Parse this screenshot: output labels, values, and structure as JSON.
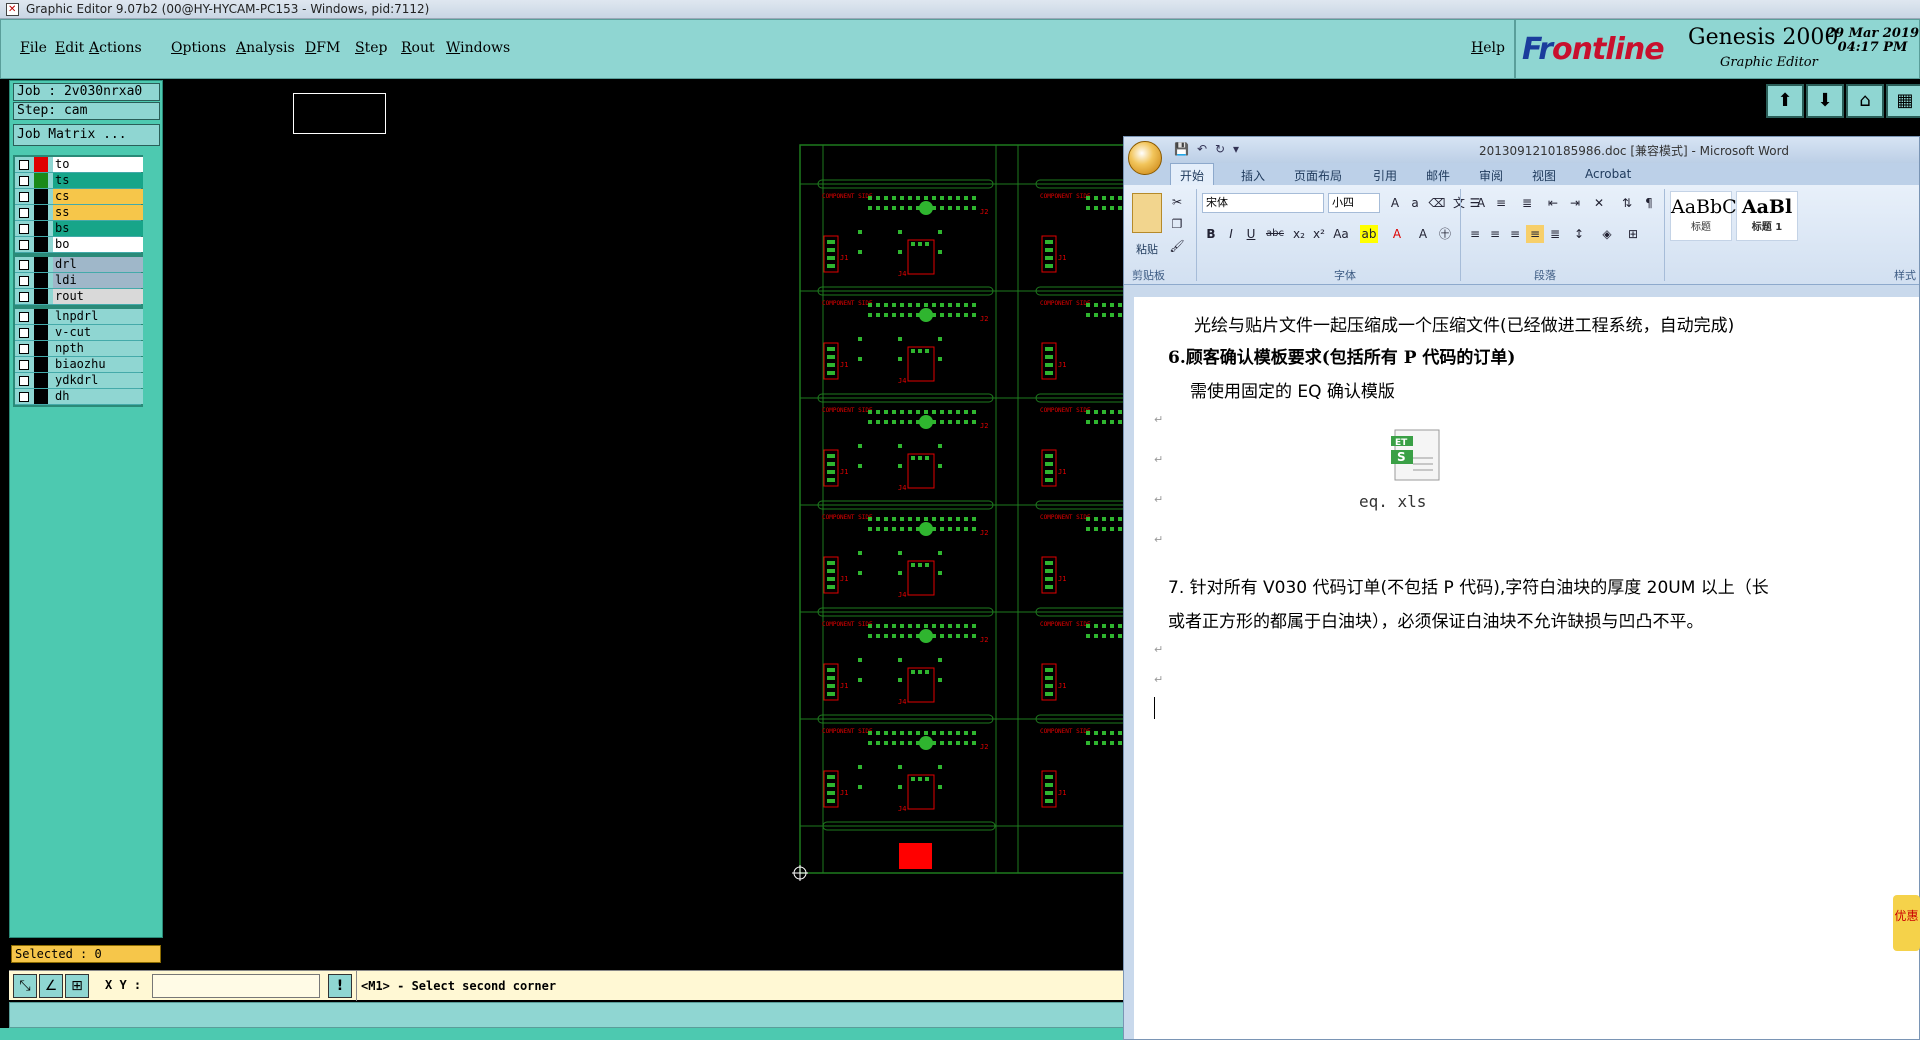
{
  "window": {
    "title": "Graphic Editor 9.07b2 (00@HY-HYCAM-PC153 - Windows, pid:7112)"
  },
  "menu": [
    "File",
    "Edit",
    "Actions",
    "Options",
    "Analysis",
    "DFM",
    "Step",
    "Rout",
    "Windows"
  ],
  "help": "Help",
  "brand": {
    "logo_a": "Fr",
    "logo_b": "ontline",
    "product": "Genesis 2000",
    "subtitle": "Graphic Editor",
    "date": "29 Mar 2019",
    "time": "04:17 PM"
  },
  "job": {
    "job_line": "Job : 2v030nrxa0",
    "step_line": "Step: cam",
    "matrix_button": "Job Matrix ..."
  },
  "layers": {
    "group1": [
      {
        "name": "to",
        "swatch": "#e00000",
        "color": "#ffffff"
      },
      {
        "name": "ts",
        "swatch": "#1a8a1a",
        "color": "#17a589"
      },
      {
        "name": "cs",
        "swatch": "#000000",
        "color": "#f6c64a"
      },
      {
        "name": "ss",
        "swatch": "#000000",
        "color": "#f6c64a"
      },
      {
        "name": "bs",
        "swatch": "#000000",
        "color": "#17a589"
      },
      {
        "name": "bo",
        "swatch": "#000000",
        "color": "#ffffff"
      }
    ],
    "group2": [
      {
        "name": "drl",
        "swatch": "#000000",
        "color": "#9fb7c9"
      },
      {
        "name": "ldi",
        "swatch": "#000000",
        "color": "#9fb7c9"
      },
      {
        "name": "rout",
        "swatch": "#000000",
        "color": "#d9d9d9"
      }
    ],
    "group3": [
      {
        "name": "lnpdrl",
        "swatch": "#000000",
        "color": "#8fd6d2"
      },
      {
        "name": "v-cut",
        "swatch": "#000000",
        "color": "#8fd6d2"
      },
      {
        "name": "npth",
        "swatch": "#000000",
        "color": "#8fd6d2"
      },
      {
        "name": "biaozhu",
        "swatch": "#000000",
        "color": "#8fd6d2"
      },
      {
        "name": "ydkdrl",
        "swatch": "#000000",
        "color": "#8fd6d2"
      },
      {
        "name": "dh",
        "swatch": "#000000",
        "color": "#8fd6d2"
      }
    ]
  },
  "selected": "Selected : 0",
  "status": {
    "xy_label": "X Y :",
    "xy_value": "",
    "message": "<M1> - Select second corner"
  },
  "pcb": {
    "silk_title": "COMPONENT SIDE",
    "label_j1": "J1",
    "label_j4": "J4",
    "label_j2": "J2"
  },
  "word": {
    "doc_title": "2013091210185986.doc [兼容模式] - Microsoft Word",
    "tabs": [
      "开始",
      "插入",
      "页面布局",
      "引用",
      "邮件",
      "审阅",
      "视图",
      "Acrobat"
    ],
    "font_name": "宋体",
    "font_size": "小四",
    "paste": "粘贴",
    "groups": [
      "剪贴板",
      "字体",
      "段落",
      "样式"
    ],
    "styles": [
      {
        "sample": "AaBbC",
        "name": "标题"
      },
      {
        "sample": "AaBl",
        "name": "标题 1"
      }
    ],
    "lines": [
      "光绘与贴片文件一起压缩成一个压缩文件(已经做进工程系统，自动完成)",
      "6.顾客确认模板要求(包括所有 P 代码的订单)",
      "需使用固定的 EQ 确认模版",
      "7.  针对所有 V030 代码订单(不包括 P 代码),字符白油块的厚度 20UM 以上（长",
      "或者正方形的都属于白油块），必须保证白油块不允许缺损与凹凸不平。"
    ],
    "attachment": "eq. xls",
    "attachment_badge": "ET"
  },
  "side_ad": "优惠",
  "colors": {
    "menu_bg": "#8fd6d2",
    "panel_bg": "#4dc9b0",
    "pcb_green": "#1e7a1e",
    "pcb_red": "#e00000"
  }
}
